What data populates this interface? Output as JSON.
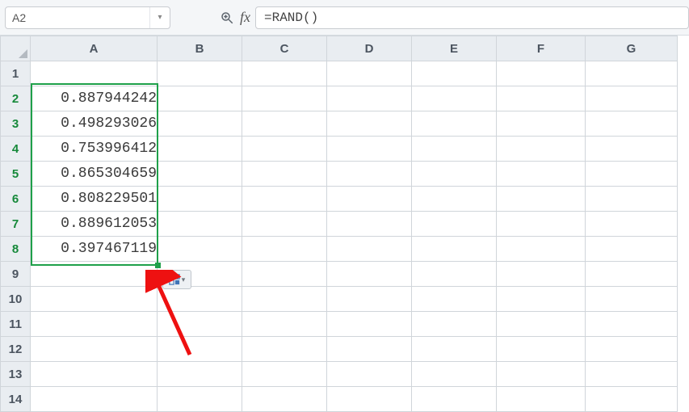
{
  "namebox": {
    "value": "A2",
    "dropdown_glyph": "▾"
  },
  "fx": {
    "label": "fx"
  },
  "formula": {
    "value": "=RAND()"
  },
  "columns": [
    "A",
    "B",
    "C",
    "D",
    "E",
    "F",
    "G"
  ],
  "rows": [
    "1",
    "2",
    "3",
    "4",
    "5",
    "6",
    "7",
    "8",
    "9",
    "10",
    "11",
    "12",
    "13",
    "14"
  ],
  "selected_rowheads": [
    "2",
    "3",
    "4",
    "5",
    "6",
    "7",
    "8"
  ],
  "cells": {
    "A2": "0.887944242",
    "A3": "0.498293026",
    "A4": "0.753996412",
    "A5": "0.865304659",
    "A6": "0.808229501",
    "A7": "0.889612053",
    "A8": "0.397467119"
  },
  "autofill": {
    "caret": "▾"
  }
}
